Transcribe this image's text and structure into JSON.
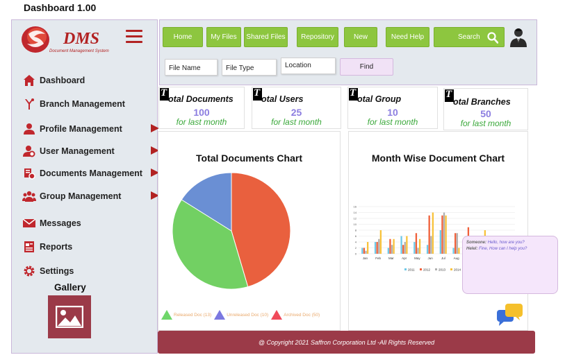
{
  "app": {
    "title": "Dashboard 1.00"
  },
  "brand": {
    "name": "DMS",
    "tagline": "Document Management System",
    "accent": "#b22222"
  },
  "sidebar": {
    "items": [
      {
        "label": "Dashboard",
        "icon": "home-icon",
        "has_arrow": false
      },
      {
        "label": "Branch Management",
        "icon": "branch-icon",
        "has_arrow": false
      },
      {
        "label": "Profile Management",
        "icon": "person-icon",
        "has_arrow": true
      },
      {
        "label": "User Management",
        "icon": "user-gear-icon",
        "has_arrow": true
      },
      {
        "label": "Documents Management",
        "icon": "documents-icon",
        "has_arrow": true
      },
      {
        "label": "Group Management",
        "icon": "group-icon",
        "has_arrow": true
      },
      {
        "label": "Messages",
        "icon": "envelope-icon",
        "has_arrow": false
      },
      {
        "label": "Reports",
        "icon": "report-icon",
        "has_arrow": false
      },
      {
        "label": "Settings",
        "icon": "gear-icon",
        "has_arrow": false
      }
    ],
    "gallery_label": "Gallery"
  },
  "nav": {
    "buttons": [
      "Home",
      "My Files",
      "Shared Files",
      "Repository",
      "New",
      "Need Help"
    ],
    "search_label": "Search",
    "color": "#8dc63f"
  },
  "filters": {
    "file_name": "File Name",
    "file_type": "File Type",
    "location": "Location",
    "find_label": "Find"
  },
  "stats": [
    {
      "title": "otal Documents",
      "value": "100",
      "sub": "for last month"
    },
    {
      "title": "otal Users",
      "value": "25",
      "sub": "for last month"
    },
    {
      "title": "otal Group",
      "value": "10",
      "sub": "for last month"
    },
    {
      "title": "otal Branches",
      "value": "50",
      "sub": "for last month"
    }
  ],
  "pie_panel": {
    "title": "Total Documents Chart",
    "legend": [
      {
        "label": "Released Doc (13)",
        "color": "#6fd66a"
      },
      {
        "label": "Unreleased Doc (10)",
        "color": "#7b78e0"
      },
      {
        "label": "Archived Doc (50)",
        "color": "#f04a5a"
      }
    ]
  },
  "bar_panel": {
    "title": "Month Wise Document Chart"
  },
  "chart_data": [
    {
      "type": "pie",
      "title": "Total Documents Chart",
      "slices": [
        {
          "value": 45.5,
          "color": "#e9603e"
        },
        {
          "value": 38.5,
          "color": "#72d063"
        },
        {
          "value": 16.0,
          "color": "#6a8fd4"
        }
      ]
    },
    {
      "type": "bar",
      "title": "Month Wise Document Chart",
      "categories": [
        "Jan",
        "Feb",
        "Mar",
        "Apr",
        "May",
        "Jun",
        "Jul",
        "Aug",
        "Sep",
        "Oct",
        "Nov",
        "Dec"
      ],
      "ylim": [
        0,
        16
      ],
      "yticks": [
        "0",
        "2",
        "4",
        "6",
        "8",
        "10",
        "12",
        "14",
        "16"
      ],
      "series": [
        {
          "name": "2011",
          "color": "#6fc9e8",
          "values": [
            2,
            4,
            2,
            6,
            4,
            3,
            8,
            2,
            4,
            3,
            5,
            2
          ]
        },
        {
          "name": "2012",
          "color": "#f0603a",
          "values": [
            2,
            4,
            5,
            3,
            7,
            13,
            13,
            7,
            9,
            3,
            4,
            6
          ]
        },
        {
          "name": "2013",
          "color": "#b0b0b0",
          "values": [
            1,
            5,
            3,
            4,
            2,
            6,
            14,
            7,
            4,
            3,
            2,
            5
          ]
        },
        {
          "name": "2014",
          "color": "#f8c23a",
          "values": [
            4,
            8,
            5,
            6,
            5,
            14,
            13,
            2,
            6,
            8,
            5,
            4
          ]
        }
      ]
    }
  ],
  "footer": {
    "text": "@ Copyright 2021 Saffron Corporation Ltd -All Rights Reserved"
  },
  "chat": {
    "lines": [
      {
        "who": "Someone:",
        "msg": "Hello, how are you?"
      },
      {
        "who": "Helel:",
        "msg": "Fine, How can I help you?"
      }
    ]
  }
}
